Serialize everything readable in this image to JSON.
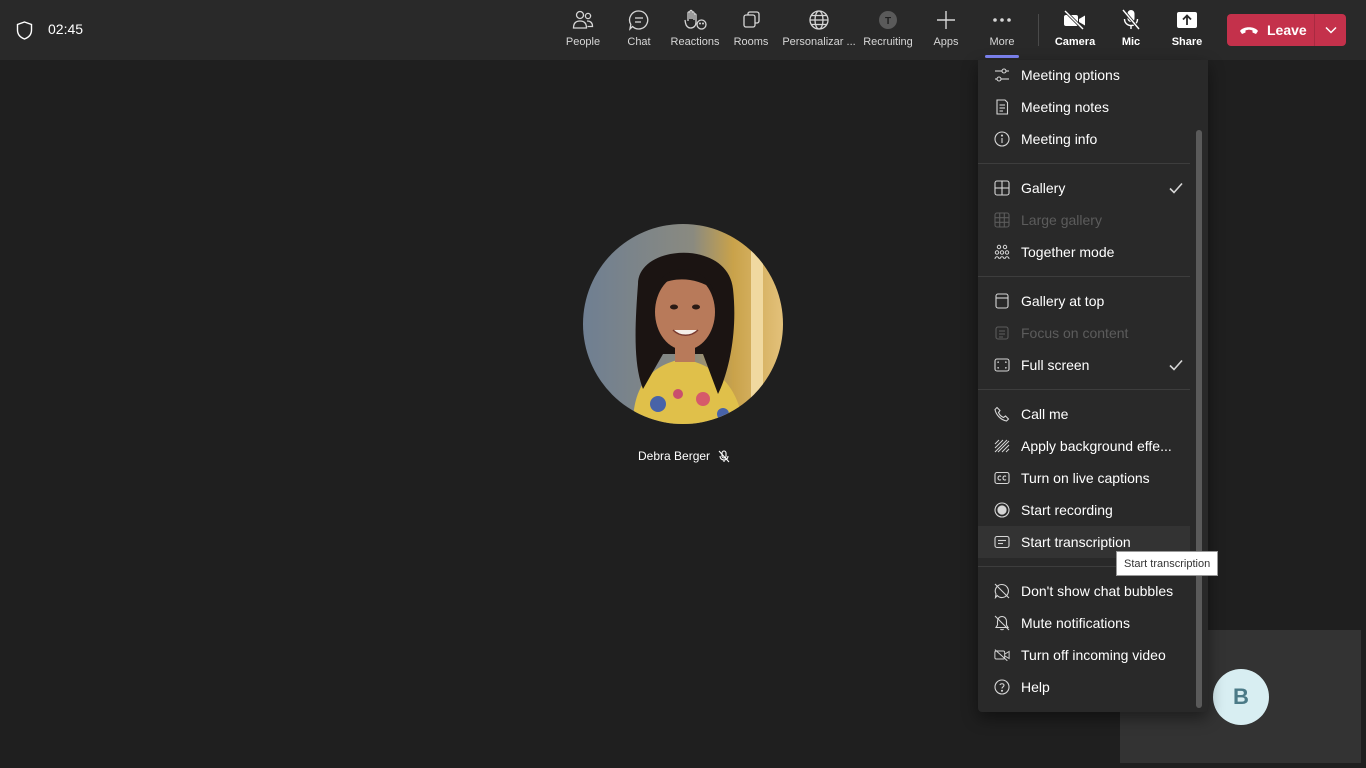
{
  "topbar": {
    "timer": "02:45",
    "buttons": {
      "people": "People",
      "chat": "Chat",
      "reactions": "Reactions",
      "rooms": "Rooms",
      "personalize": "Personalizar ...",
      "recruiting": "Recruiting",
      "apps": "Apps",
      "more": "More",
      "camera": "Camera",
      "mic": "Mic",
      "share": "Share"
    },
    "leave": "Leave"
  },
  "stage": {
    "participant_name": "Debra Berger",
    "self_initial": "B"
  },
  "more_menu": {
    "items": [
      {
        "label": "Meeting options",
        "icon": "sliders-icon"
      },
      {
        "label": "Meeting notes",
        "icon": "notes-icon"
      },
      {
        "label": "Meeting info",
        "icon": "info-icon"
      },
      {
        "label": "Gallery",
        "icon": "gallery-icon",
        "checked": true
      },
      {
        "label": "Large gallery",
        "icon": "large-gallery-icon",
        "disabled": true
      },
      {
        "label": "Together mode",
        "icon": "together-mode-icon"
      },
      {
        "label": "Gallery at top",
        "icon": "gallery-top-icon"
      },
      {
        "label": "Focus on content",
        "icon": "focus-content-icon",
        "disabled": true
      },
      {
        "label": "Full screen",
        "icon": "full-screen-icon",
        "checked": true
      },
      {
        "label": "Call me",
        "icon": "phone-icon"
      },
      {
        "label": "Apply background effe...",
        "icon": "background-effects-icon"
      },
      {
        "label": "Turn on live captions",
        "icon": "captions-icon"
      },
      {
        "label": "Start recording",
        "icon": "record-icon"
      },
      {
        "label": "Start transcription",
        "icon": "transcription-icon"
      },
      {
        "label": "Don't show chat bubbles",
        "icon": "chat-bubbles-off-icon"
      },
      {
        "label": "Mute notifications",
        "icon": "bell-off-icon"
      },
      {
        "label": "Turn off incoming video",
        "icon": "video-off-icon"
      },
      {
        "label": "Help",
        "icon": "help-icon"
      }
    ],
    "tooltip": "Start transcription"
  },
  "colors": {
    "leave": "#c4314b",
    "accent": "#7f85f5",
    "background": "#1f1f1f",
    "topbar": "#292929"
  }
}
